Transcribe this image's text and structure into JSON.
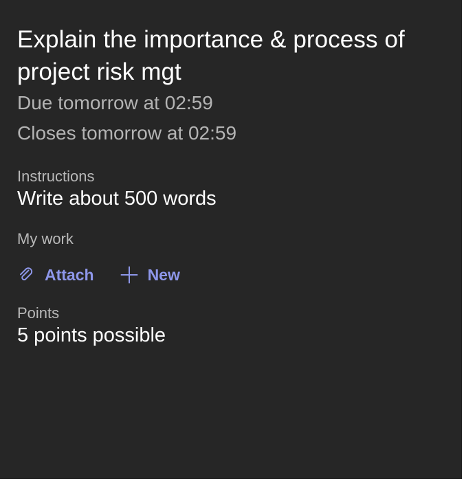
{
  "assignment": {
    "title": "Explain the importance & process of project risk mgt",
    "due": "Due tomorrow at 02:59",
    "closes": "Closes tomorrow at 02:59"
  },
  "instructions": {
    "label": "Instructions",
    "text": "Write about 500 words"
  },
  "my_work": {
    "label": "My work",
    "attach_label": "Attach",
    "new_label": "New"
  },
  "points": {
    "label": "Points",
    "text": "5 points possible"
  },
  "colors": {
    "background": "#262626",
    "accent": "#8e97ea",
    "primary_text": "#ffffff",
    "secondary_text": "#b4b4b4"
  },
  "icons": {
    "attach": "paperclip-icon",
    "new": "plus-icon"
  }
}
